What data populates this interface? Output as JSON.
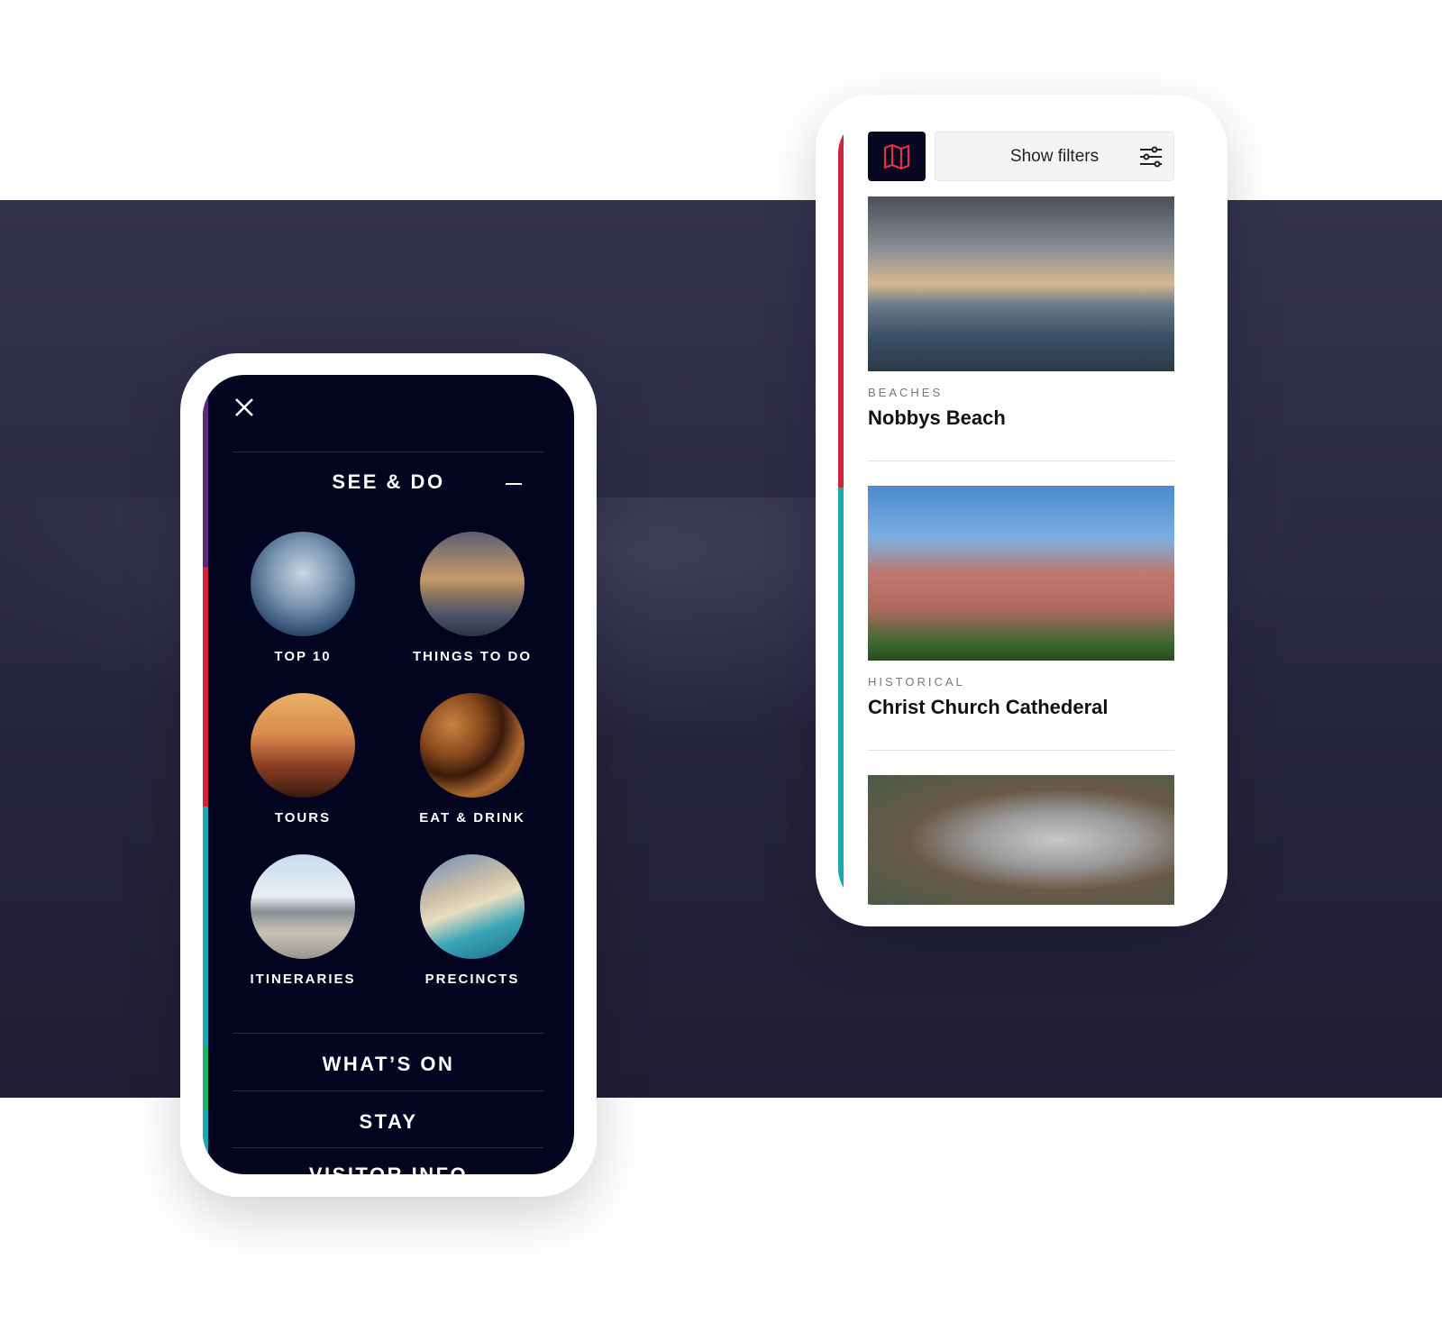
{
  "left_phone": {
    "close_icon": "close-icon",
    "section_title": "SEE & DO",
    "collapse_icon": "minus-icon",
    "tiles": [
      {
        "label": "TOP 10"
      },
      {
        "label": "THINGS TO DO"
      },
      {
        "label": "TOURS"
      },
      {
        "label": "EAT & DRINK"
      },
      {
        "label": "ITINERARIES"
      },
      {
        "label": "PRECINCTS"
      }
    ],
    "menu": [
      {
        "label": "WHAT’S ON"
      },
      {
        "label": "STAY"
      },
      {
        "label": "VISITOR INFO"
      }
    ]
  },
  "right_phone": {
    "map_icon": "map-icon",
    "filters_label": "Show filters",
    "filters_icon": "sliders-icon",
    "cards": [
      {
        "category": "BEACHES",
        "title": "Nobbys Beach"
      },
      {
        "category": "HISTORICAL",
        "title": "Christ Church Cathederal"
      },
      {
        "category": "",
        "title": ""
      }
    ]
  },
  "colors": {
    "menu_bg": "#03041f",
    "accent_red": "#d0243a",
    "accent_teal": "#1da5b8",
    "accent_purple": "#5b2a7a",
    "accent_green": "#1fb06a"
  }
}
